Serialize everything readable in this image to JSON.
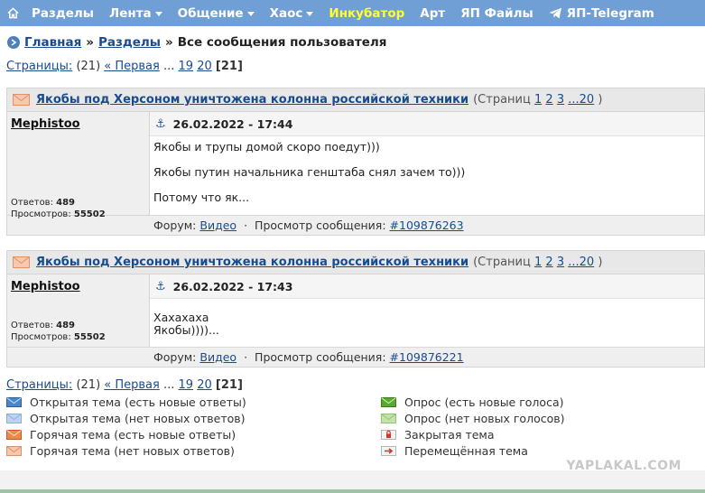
{
  "nav": {
    "items": [
      {
        "label": "Разделы",
        "dropdown": false,
        "accent": false
      },
      {
        "label": "Лента",
        "dropdown": true,
        "accent": false
      },
      {
        "label": "Общение",
        "dropdown": true,
        "accent": false
      },
      {
        "label": "Хаос",
        "dropdown": true,
        "accent": false
      },
      {
        "label": "Инкубатор",
        "dropdown": false,
        "accent": true
      },
      {
        "label": "Арт",
        "dropdown": false,
        "accent": false
      },
      {
        "label": "ЯП Файлы",
        "dropdown": false,
        "accent": false
      },
      {
        "label": "ЯП-Telegram",
        "dropdown": false,
        "accent": false
      }
    ],
    "colors": {
      "bar": "#6f9fd4",
      "accent": "#ffff33"
    }
  },
  "breadcrumb": {
    "home": "Главная",
    "sections": "Разделы",
    "sep": "»",
    "current": "Все сообщения пользователя"
  },
  "pager": {
    "label": "Страницы:",
    "count": "(21)",
    "first": "« Первая",
    "ellipsis": "...",
    "p1": "19",
    "p2": "20",
    "current": "[21]"
  },
  "posts": [
    {
      "topic": "Якобы под Херсоном уничтожена колонна российской техники",
      "pages_prefix": "(Страниц",
      "pages": [
        "1",
        "2",
        "3",
        "...20"
      ],
      "pages_suffix": ")",
      "author": "Mephistoo",
      "replies_label": "Ответов:",
      "replies": "489",
      "views_label": "Просмотров:",
      "views": "55502",
      "date": "26.02.2022 - 17:44",
      "lines": [
        "Якобы и трупы домой скоро поедут)))",
        "",
        "Якобы путин начальника генштаба снял зачем то)))",
        "",
        "Потому что як..."
      ],
      "forum_label": "Форум:",
      "forum": "Видео",
      "dot": "·",
      "view_label": "Просмотр сообщения:",
      "msg": "#109876263"
    },
    {
      "topic": "Якобы под Херсоном уничтожена колонна российской техники",
      "pages_prefix": "(Страниц",
      "pages": [
        "1",
        "2",
        "3",
        "...20"
      ],
      "pages_suffix": ")",
      "author": "Mephistoo",
      "replies_label": "Ответов:",
      "replies": "489",
      "views_label": "Просмотров:",
      "views": "55502",
      "date": "26.02.2022 - 17:43",
      "lines": [
        "Хахахаха",
        "Якобы))))..."
      ],
      "forum_label": "Форум:",
      "forum": "Видео",
      "dot": "·",
      "view_label": "Просмотр сообщения:",
      "msg": "#109876221"
    }
  ],
  "legend": {
    "left": [
      {
        "label": "Открытая тема (есть новые ответы)",
        "icon": "envelope-blue-icon",
        "color": "#4b86c8"
      },
      {
        "label": "Открытая тема (нет новых ответов)",
        "icon": "envelope-lightblue-icon",
        "color": "#a9c8e8"
      },
      {
        "label": "Горячая тема (есть новые ответы)",
        "icon": "envelope-orange-icon",
        "color": "#e8793a"
      },
      {
        "label": "Горячая тема (нет новых ответов)",
        "icon": "envelope-peach-icon",
        "color": "#f2b99a"
      }
    ],
    "right": [
      {
        "label": "Опрос (есть новые голоса)",
        "icon": "envelope-green-icon",
        "color": "#5aa832"
      },
      {
        "label": "Опрос (нет новых голосов)",
        "icon": "envelope-lightgreen-icon",
        "color": "#b5dc9b"
      },
      {
        "label": "Закрытая тема",
        "icon": "lock-icon",
        "color": "#d0342c"
      },
      {
        "label": "Перемещённая тема",
        "icon": "moved-icon",
        "color": "#d0342c"
      }
    ]
  },
  "watermark": "YAPLAKAL.COM"
}
